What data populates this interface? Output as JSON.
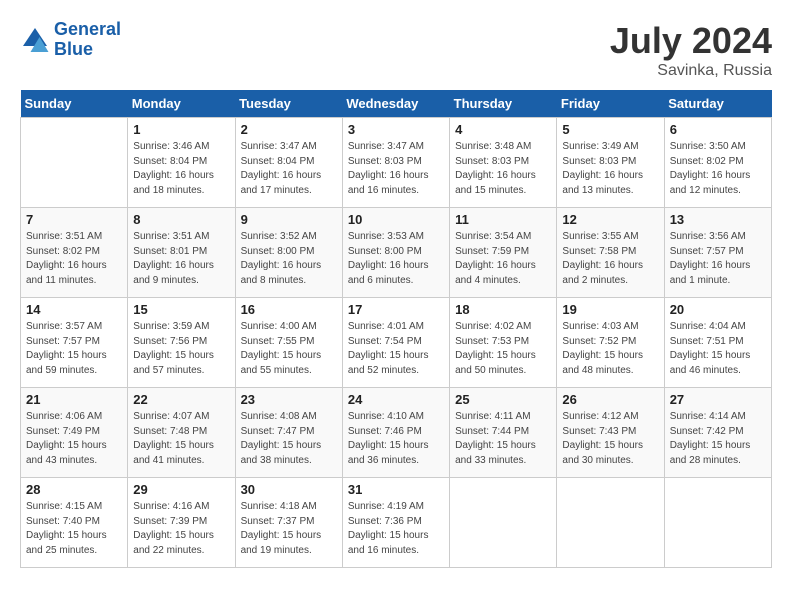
{
  "header": {
    "logo_line1": "General",
    "logo_line2": "Blue",
    "month": "July 2024",
    "location": "Savinka, Russia"
  },
  "weekdays": [
    "Sunday",
    "Monday",
    "Tuesday",
    "Wednesday",
    "Thursday",
    "Friday",
    "Saturday"
  ],
  "weeks": [
    [
      {
        "day": "",
        "info": ""
      },
      {
        "day": "1",
        "info": "Sunrise: 3:46 AM\nSunset: 8:04 PM\nDaylight: 16 hours\nand 18 minutes."
      },
      {
        "day": "2",
        "info": "Sunrise: 3:47 AM\nSunset: 8:04 PM\nDaylight: 16 hours\nand 17 minutes."
      },
      {
        "day": "3",
        "info": "Sunrise: 3:47 AM\nSunset: 8:03 PM\nDaylight: 16 hours\nand 16 minutes."
      },
      {
        "day": "4",
        "info": "Sunrise: 3:48 AM\nSunset: 8:03 PM\nDaylight: 16 hours\nand 15 minutes."
      },
      {
        "day": "5",
        "info": "Sunrise: 3:49 AM\nSunset: 8:03 PM\nDaylight: 16 hours\nand 13 minutes."
      },
      {
        "day": "6",
        "info": "Sunrise: 3:50 AM\nSunset: 8:02 PM\nDaylight: 16 hours\nand 12 minutes."
      }
    ],
    [
      {
        "day": "7",
        "info": "Sunrise: 3:51 AM\nSunset: 8:02 PM\nDaylight: 16 hours\nand 11 minutes."
      },
      {
        "day": "8",
        "info": "Sunrise: 3:51 AM\nSunset: 8:01 PM\nDaylight: 16 hours\nand 9 minutes."
      },
      {
        "day": "9",
        "info": "Sunrise: 3:52 AM\nSunset: 8:00 PM\nDaylight: 16 hours\nand 8 minutes."
      },
      {
        "day": "10",
        "info": "Sunrise: 3:53 AM\nSunset: 8:00 PM\nDaylight: 16 hours\nand 6 minutes."
      },
      {
        "day": "11",
        "info": "Sunrise: 3:54 AM\nSunset: 7:59 PM\nDaylight: 16 hours\nand 4 minutes."
      },
      {
        "day": "12",
        "info": "Sunrise: 3:55 AM\nSunset: 7:58 PM\nDaylight: 16 hours\nand 2 minutes."
      },
      {
        "day": "13",
        "info": "Sunrise: 3:56 AM\nSunset: 7:57 PM\nDaylight: 16 hours\nand 1 minute."
      }
    ],
    [
      {
        "day": "14",
        "info": "Sunrise: 3:57 AM\nSunset: 7:57 PM\nDaylight: 15 hours\nand 59 minutes."
      },
      {
        "day": "15",
        "info": "Sunrise: 3:59 AM\nSunset: 7:56 PM\nDaylight: 15 hours\nand 57 minutes."
      },
      {
        "day": "16",
        "info": "Sunrise: 4:00 AM\nSunset: 7:55 PM\nDaylight: 15 hours\nand 55 minutes."
      },
      {
        "day": "17",
        "info": "Sunrise: 4:01 AM\nSunset: 7:54 PM\nDaylight: 15 hours\nand 52 minutes."
      },
      {
        "day": "18",
        "info": "Sunrise: 4:02 AM\nSunset: 7:53 PM\nDaylight: 15 hours\nand 50 minutes."
      },
      {
        "day": "19",
        "info": "Sunrise: 4:03 AM\nSunset: 7:52 PM\nDaylight: 15 hours\nand 48 minutes."
      },
      {
        "day": "20",
        "info": "Sunrise: 4:04 AM\nSunset: 7:51 PM\nDaylight: 15 hours\nand 46 minutes."
      }
    ],
    [
      {
        "day": "21",
        "info": "Sunrise: 4:06 AM\nSunset: 7:49 PM\nDaylight: 15 hours\nand 43 minutes."
      },
      {
        "day": "22",
        "info": "Sunrise: 4:07 AM\nSunset: 7:48 PM\nDaylight: 15 hours\nand 41 minutes."
      },
      {
        "day": "23",
        "info": "Sunrise: 4:08 AM\nSunset: 7:47 PM\nDaylight: 15 hours\nand 38 minutes."
      },
      {
        "day": "24",
        "info": "Sunrise: 4:10 AM\nSunset: 7:46 PM\nDaylight: 15 hours\nand 36 minutes."
      },
      {
        "day": "25",
        "info": "Sunrise: 4:11 AM\nSunset: 7:44 PM\nDaylight: 15 hours\nand 33 minutes."
      },
      {
        "day": "26",
        "info": "Sunrise: 4:12 AM\nSunset: 7:43 PM\nDaylight: 15 hours\nand 30 minutes."
      },
      {
        "day": "27",
        "info": "Sunrise: 4:14 AM\nSunset: 7:42 PM\nDaylight: 15 hours\nand 28 minutes."
      }
    ],
    [
      {
        "day": "28",
        "info": "Sunrise: 4:15 AM\nSunset: 7:40 PM\nDaylight: 15 hours\nand 25 minutes."
      },
      {
        "day": "29",
        "info": "Sunrise: 4:16 AM\nSunset: 7:39 PM\nDaylight: 15 hours\nand 22 minutes."
      },
      {
        "day": "30",
        "info": "Sunrise: 4:18 AM\nSunset: 7:37 PM\nDaylight: 15 hours\nand 19 minutes."
      },
      {
        "day": "31",
        "info": "Sunrise: 4:19 AM\nSunset: 7:36 PM\nDaylight: 15 hours\nand 16 minutes."
      },
      {
        "day": "",
        "info": ""
      },
      {
        "day": "",
        "info": ""
      },
      {
        "day": "",
        "info": ""
      }
    ]
  ]
}
